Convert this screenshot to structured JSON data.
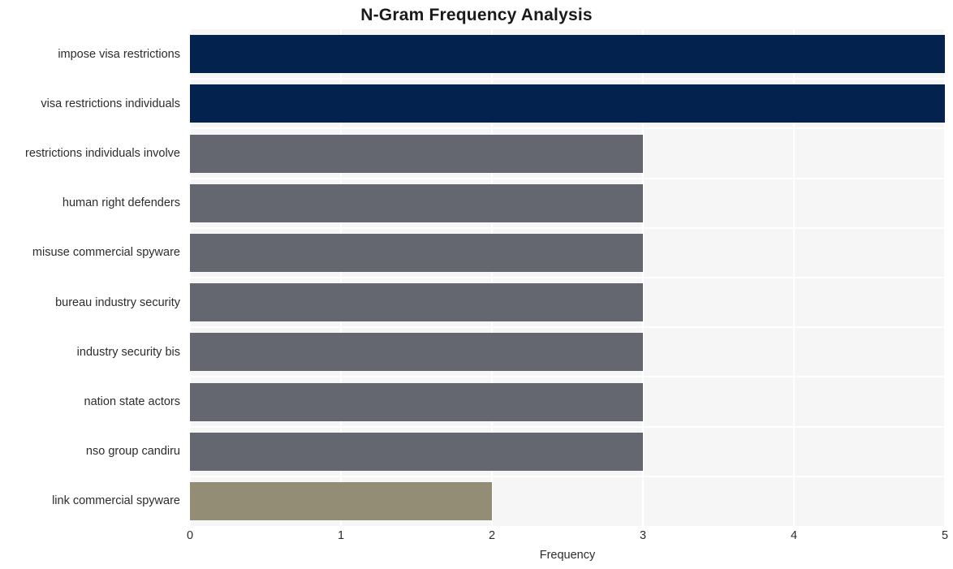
{
  "chart_data": {
    "type": "bar",
    "orientation": "horizontal",
    "title": "N-Gram Frequency Analysis",
    "xlabel": "Frequency",
    "ylabel": "",
    "xlim": [
      0,
      5
    ],
    "xticks": [
      "0",
      "1",
      "2",
      "3",
      "4",
      "5"
    ],
    "grid": true,
    "legend": null,
    "categories": [
      "impose visa restrictions",
      "visa restrictions individuals",
      "restrictions individuals involve",
      "human right defenders",
      "misuse commercial spyware",
      "bureau industry security",
      "industry security bis",
      "nation state actors",
      "nso group candiru",
      "link commercial spyware"
    ],
    "values": [
      5,
      5,
      3,
      3,
      3,
      3,
      3,
      3,
      3,
      2
    ],
    "bar_colors": [
      "#03234e",
      "#03234e",
      "#64676f",
      "#64676f",
      "#64676f",
      "#64676f",
      "#64676f",
      "#64676f",
      "#64676f",
      "#938d75"
    ]
  },
  "style": {
    "plot_background": "#f6f6f7",
    "grid_color": "#ffffff",
    "page_background": "#ffffff",
    "text_color": "#2c2c2c",
    "title_color": "#1a1a1a"
  }
}
